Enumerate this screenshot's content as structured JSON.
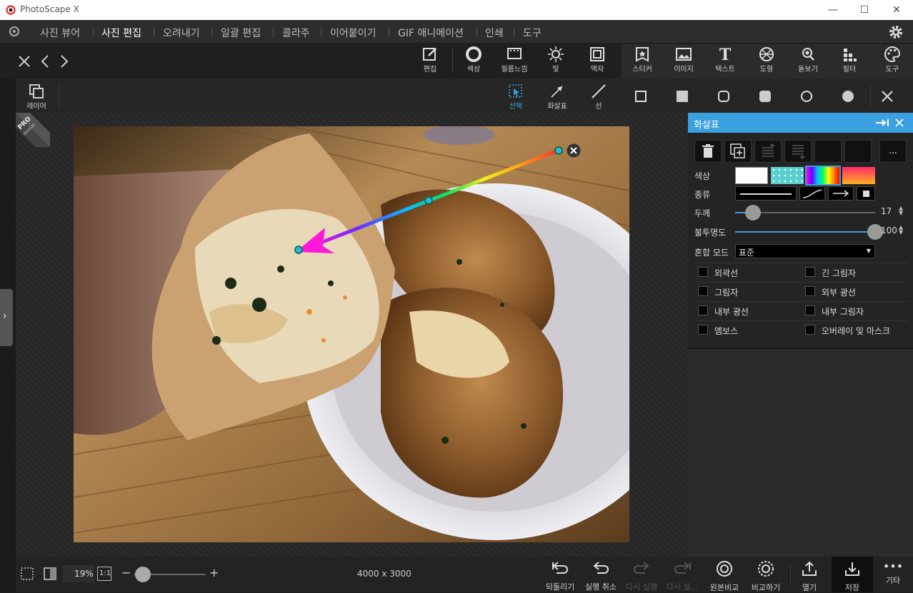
{
  "window": {
    "title": "PhotoScape X"
  },
  "menu": {
    "items": [
      {
        "label": "사진 뷰어",
        "active": false
      },
      {
        "label": "사진 편집",
        "active": true
      },
      {
        "label": "오려내기",
        "active": false
      },
      {
        "label": "일괄 편집",
        "active": false
      },
      {
        "label": "콜라주",
        "active": false
      },
      {
        "label": "이어붙이기",
        "active": false
      },
      {
        "label": "GIF 애니메이션",
        "active": false
      },
      {
        "label": "인쇄",
        "active": false
      },
      {
        "label": "도구",
        "active": false
      }
    ]
  },
  "toolbar": {
    "tools": [
      {
        "label": "편집",
        "icon": "edit-icon"
      },
      {
        "label": "색상",
        "icon": "color-icon"
      },
      {
        "label": "필름느낌",
        "icon": "film-icon"
      },
      {
        "label": "빛",
        "icon": "light-icon"
      },
      {
        "label": "액자",
        "icon": "frame-icon"
      },
      {
        "label": "스티커",
        "icon": "sticker-icon"
      },
      {
        "label": "이미지",
        "icon": "image-icon"
      },
      {
        "label": "텍스트",
        "icon": "text-icon"
      },
      {
        "label": "도형",
        "icon": "shape-icon"
      },
      {
        "label": "돋보기",
        "icon": "magnifier-icon"
      },
      {
        "label": "필터",
        "icon": "filter-icon"
      },
      {
        "label": "도구",
        "icon": "tools-icon"
      }
    ]
  },
  "subtoolbar": {
    "layer_label": "레이어",
    "select_label": "선택",
    "arrow_label": "화살표",
    "line_label": "선"
  },
  "badge": {
    "pro": "PRO",
    "version": "Version"
  },
  "panel": {
    "title": "화살표",
    "more_label": "...",
    "color_label": "색상",
    "type_label": "종류",
    "thickness_label": "두께",
    "thickness_value": "17",
    "thickness_fraction": 0.13,
    "opacity_label": "불투명도",
    "opacity_value": "100",
    "opacity_fraction": 1.0,
    "blend_label": "혼합 모드",
    "blend_value": "표준",
    "effects": [
      {
        "label": "외곽선",
        "checked": false
      },
      {
        "label": "긴 그림자",
        "checked": false
      },
      {
        "label": "그림자",
        "checked": false
      },
      {
        "label": "외부 광선",
        "checked": false
      },
      {
        "label": "내부 광선",
        "checked": false
      },
      {
        "label": "내부 그림자",
        "checked": false
      },
      {
        "label": "엠보스",
        "checked": false
      },
      {
        "label": "오버레이 및 마스크",
        "checked": false
      }
    ]
  },
  "status": {
    "zoom": "19%",
    "one_to_one": "1:1",
    "dimensions": "4000 x 3000",
    "zoom_fraction": 0.12
  },
  "bottom": {
    "revert": "되돌리기",
    "undo": "실행 취소",
    "redo": "다시 실행",
    "redo_all": "다시 실...",
    "original_compare": "원본비교",
    "compare": "비교하기",
    "open": "열기",
    "save": "저장",
    "more": "기타"
  },
  "colors": {
    "accent": "#3aa0e0",
    "arrow_head": "#ff19d9"
  }
}
